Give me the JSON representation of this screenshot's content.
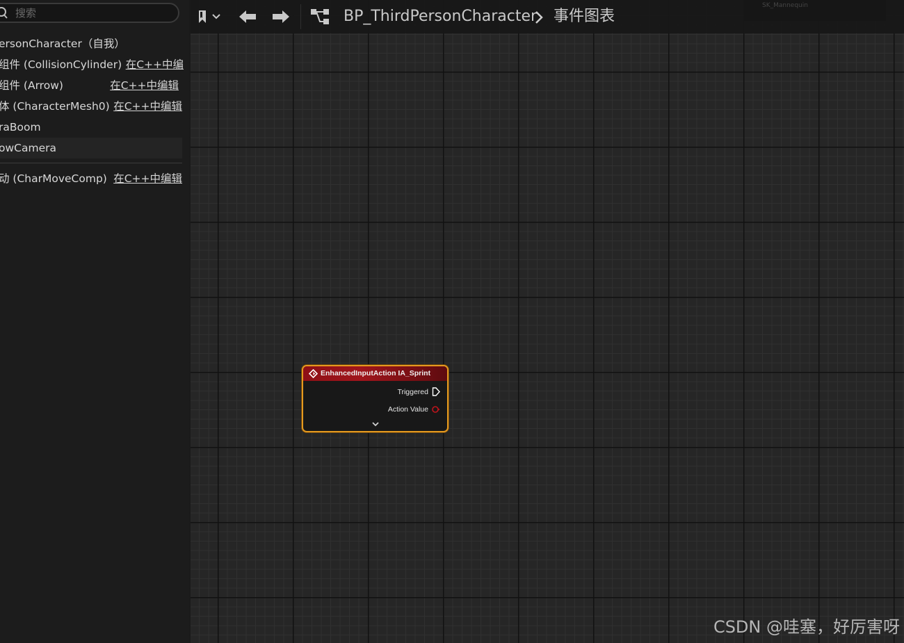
{
  "search": {
    "placeholder": "搜索"
  },
  "components": [
    {
      "label": "ersonCharacter（自我）",
      "edit_link": ""
    },
    {
      "label": "组件 (CollisionCylinder)",
      "edit_link": "在C++中编"
    },
    {
      "label": "组件 (Arrow)",
      "edit_link": "在C++中编辑"
    },
    {
      "label": "体 (CharacterMesh0)",
      "edit_link": "在C++中编辑"
    },
    {
      "label": "raBoom",
      "edit_link": ""
    },
    {
      "label": "owCamera",
      "edit_link": ""
    },
    {
      "label": "动 (CharMoveComp)",
      "edit_link": "在C++中编辑"
    }
  ],
  "toolbar": {
    "breadcrumb_class": "BP_ThirdPersonCharacter",
    "breadcrumb_graph": "事件图表",
    "mini_overlay_text": "SK_Mannequin"
  },
  "node": {
    "title": "EnhancedInputAction IA_Sprint",
    "pins": {
      "triggered": "Triggered",
      "action_value": "Action Value"
    }
  },
  "colors": {
    "node_header": "#a0151c",
    "node_border": "#e59a1f",
    "action_value_pin": "#c0141c"
  },
  "watermark": "CSDN @哇塞，好厉害呀"
}
